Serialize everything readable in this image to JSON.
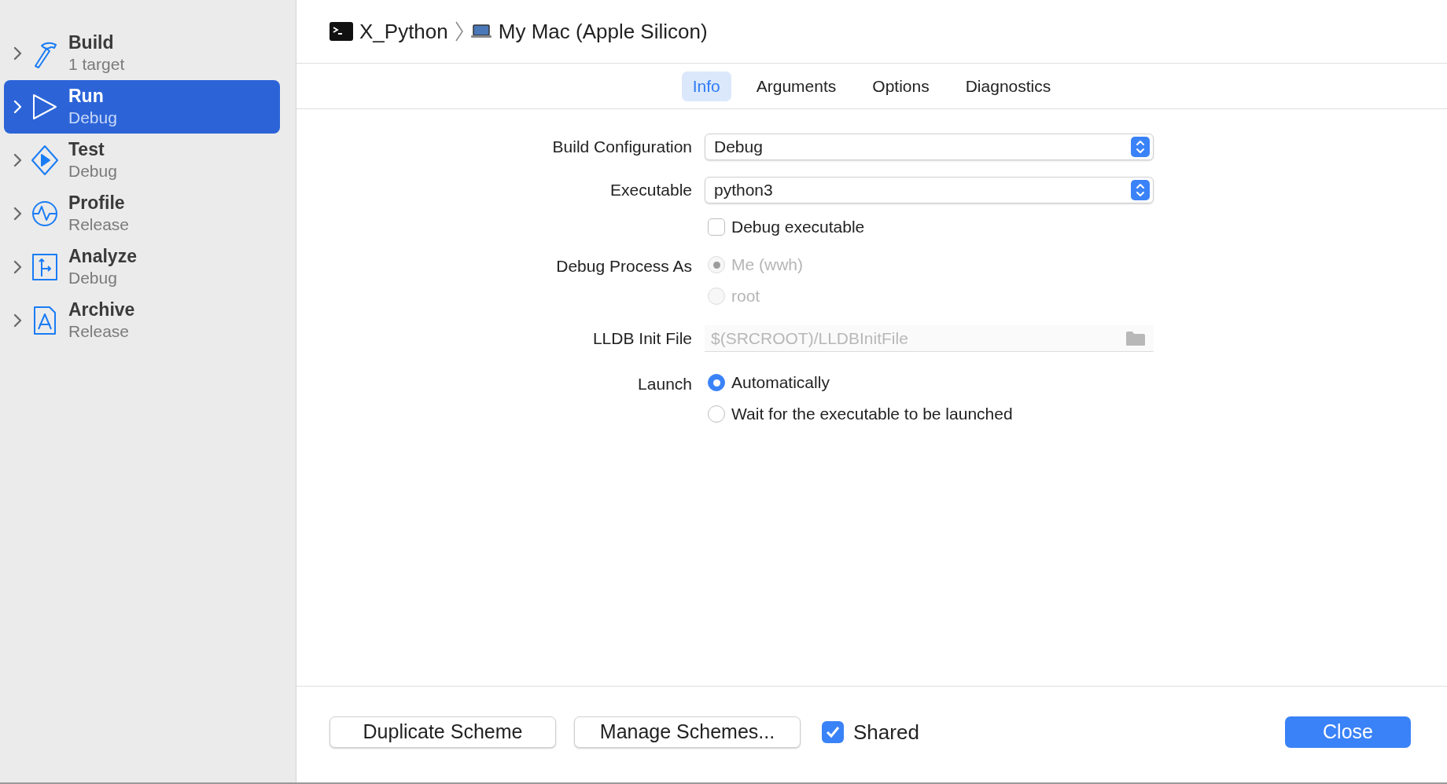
{
  "header": {
    "scheme": "X_Python",
    "destination": "My Mac (Apple Silicon)"
  },
  "sidebar": {
    "items": [
      {
        "kind": "build",
        "title": "Build",
        "subtitle": "1 target",
        "selected": false
      },
      {
        "kind": "run",
        "title": "Run",
        "subtitle": "Debug",
        "selected": true
      },
      {
        "kind": "test",
        "title": "Test",
        "subtitle": "Debug",
        "selected": false
      },
      {
        "kind": "profile",
        "title": "Profile",
        "subtitle": "Release",
        "selected": false
      },
      {
        "kind": "analyze",
        "title": "Analyze",
        "subtitle": "Debug",
        "selected": false
      },
      {
        "kind": "archive",
        "title": "Archive",
        "subtitle": "Release",
        "selected": false
      }
    ]
  },
  "tabs": [
    {
      "label": "Info",
      "selected": true
    },
    {
      "label": "Arguments",
      "selected": false
    },
    {
      "label": "Options",
      "selected": false
    },
    {
      "label": "Diagnostics",
      "selected": false
    }
  ],
  "form": {
    "rows": [
      {
        "kind": "popup",
        "label": "Build Configuration",
        "value": "Debug"
      },
      {
        "kind": "popup",
        "label": "Executable",
        "value": "python3"
      },
      {
        "kind": "checkbox",
        "text": "Debug executable",
        "checked": false
      },
      {
        "kind": "radio",
        "label": "Debug Process As",
        "disabled": true,
        "options": [
          {
            "text": "Me (wwh)",
            "selected": true
          },
          {
            "text": "root",
            "selected": false
          }
        ]
      },
      {
        "kind": "path",
        "label": "LLDB Init File",
        "placeholder": "$(SRCROOT)/LLDBInitFile"
      },
      {
        "kind": "radio",
        "label": "Launch",
        "disabled": false,
        "options": [
          {
            "text": "Automatically",
            "selected": true
          },
          {
            "text": "Wait for the executable to be launched",
            "selected": false
          }
        ]
      }
    ]
  },
  "footer": {
    "buttons": [
      "Duplicate Scheme",
      "Manage Schemes..."
    ],
    "shared": {
      "label": "Shared",
      "checked": true
    },
    "close": "Close"
  }
}
